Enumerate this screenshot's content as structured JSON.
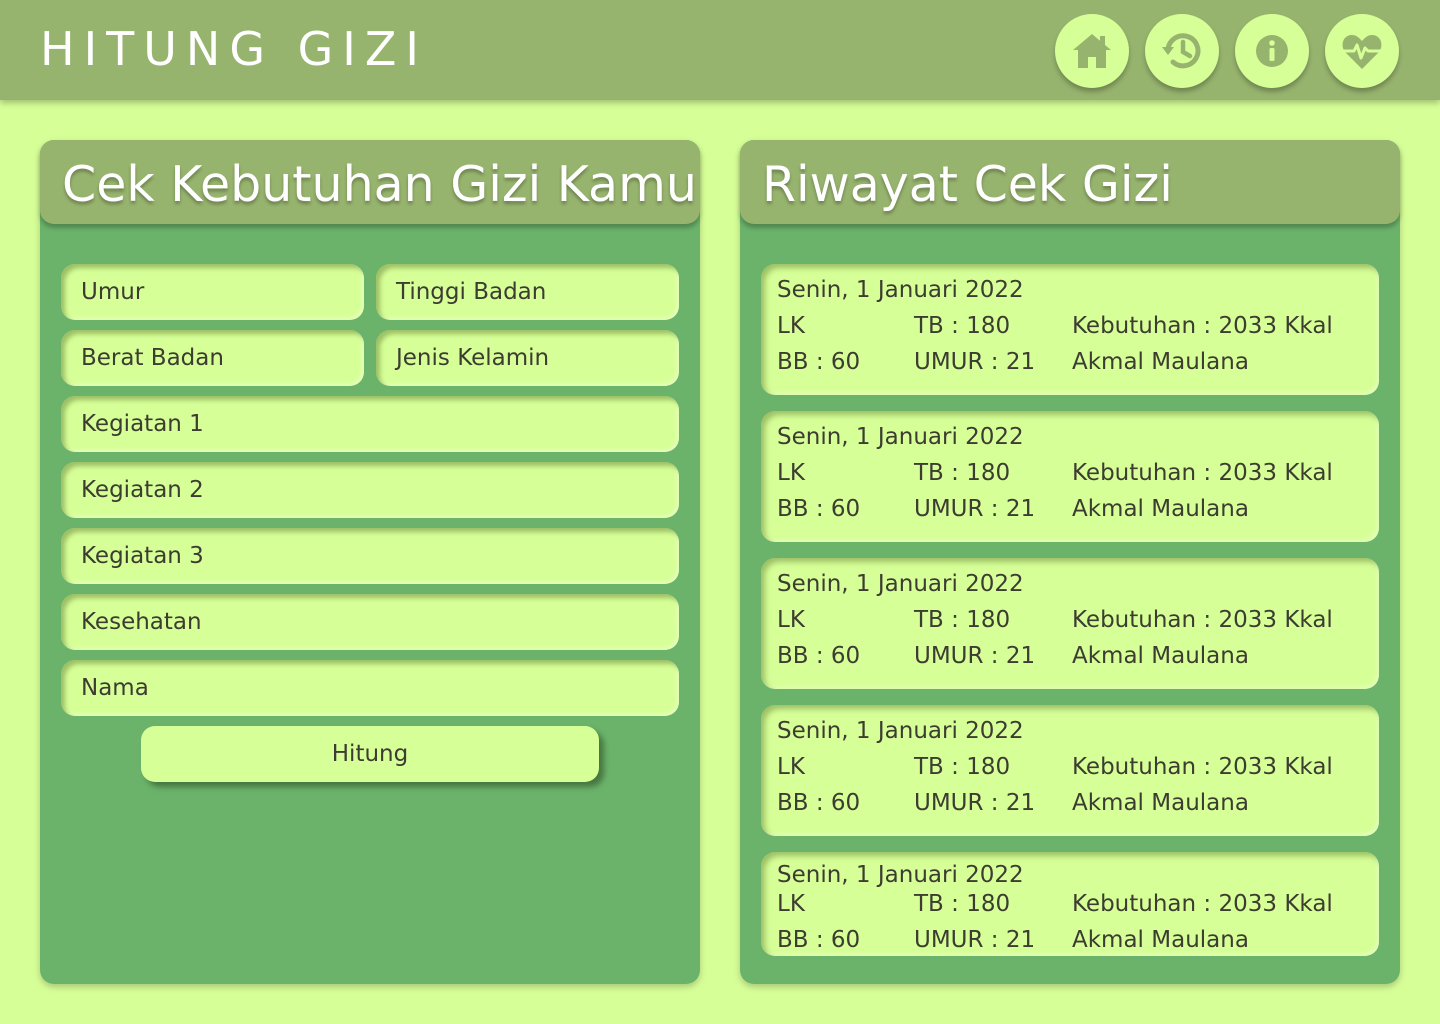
{
  "header": {
    "title": "HITUNG GIZI",
    "nav": [
      "home-icon",
      "history-icon",
      "info-icon",
      "heart-pulse-icon"
    ]
  },
  "form": {
    "title": "Cek Kebutuhan Gizi Kamu",
    "fields": {
      "umur": "Umur",
      "tinggi_badan": "Tinggi Badan",
      "berat_badan": "Berat Badan",
      "jenis_kelamin": "Jenis Kelamin",
      "kegiatan_1": "Kegiatan 1",
      "kegiatan_2": "Kegiatan 2",
      "kegiatan_3": "Kegiatan 3",
      "kesehatan": "Kesehatan",
      "nama": "Nama"
    },
    "submit_label": "Hitung"
  },
  "history": {
    "title": "Riwayat Cek Gizi",
    "records": [
      {
        "date": "Senin, 1 Januari 2022",
        "lk": "LK",
        "tb": "TB : 180",
        "kebutuhan": "Kebutuhan : 2033 Kkal",
        "bb": "BB :  60",
        "umur": "UMUR : 21",
        "nama": "Akmal Maulana"
      },
      {
        "date": "Senin, 1 Januari 2022",
        "lk": "LK",
        "tb": "TB : 180",
        "kebutuhan": "Kebutuhan : 2033 Kkal",
        "bb": "BB :  60",
        "umur": "UMUR : 21",
        "nama": "Akmal Maulana"
      },
      {
        "date": "Senin, 1 Januari 2022",
        "lk": "LK",
        "tb": "TB : 180",
        "kebutuhan": "Kebutuhan : 2033 Kkal",
        "bb": "BB :  60",
        "umur": "UMUR : 21",
        "nama": "Akmal Maulana"
      },
      {
        "date": "Senin, 1 Januari 2022",
        "lk": "LK",
        "tb": "TB : 180",
        "kebutuhan": "Kebutuhan : 2033 Kkal",
        "bb": "BB :  60",
        "umur": "UMUR : 21",
        "nama": "Akmal Maulana"
      },
      {
        "date": "Senin, 1 Januari 2022",
        "lk": "LK",
        "tb": "TB : 180",
        "kebutuhan": "Kebutuhan : 2033 Kkal",
        "bb": "BB :  60",
        "umur": "UMUR : 21",
        "nama": "Akmal Maulana"
      }
    ]
  },
  "colors": {
    "background": "#d7ff98",
    "header": "#97b46e",
    "panel": "#6bb36b",
    "icon": "#97b46e",
    "title_text": "#ffffff"
  }
}
